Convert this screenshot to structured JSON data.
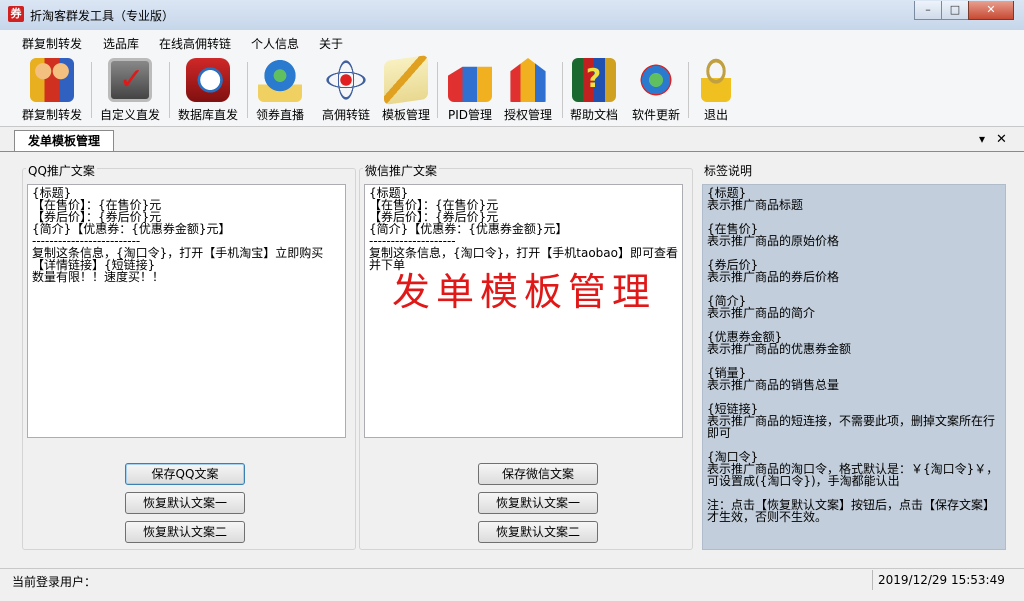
{
  "window": {
    "title": "折淘客群发工具（专业版）",
    "app_icon": "券",
    "minimize": "–",
    "maximize": "□",
    "close": "✕"
  },
  "menu": [
    "群复制转发",
    "选品库",
    "在线高佣转链",
    "个人信息",
    "关于"
  ],
  "toolbar": [
    {
      "label": "群复制转发",
      "icon": "users-icon"
    },
    {
      "label": "自定义直发",
      "icon": "tv-check-icon"
    },
    {
      "label": "数据库直发",
      "icon": "database-clock-icon"
    },
    {
      "label": "领券直播",
      "icon": "globe-paper-icon"
    },
    {
      "label": "高佣转链",
      "icon": "atom-icon"
    },
    {
      "label": "模板管理",
      "icon": "template-pencil-icon"
    },
    {
      "label": "PID管理",
      "icon": "blocks-folder-icon"
    },
    {
      "label": "授权管理",
      "icon": "blocks-hand-icon"
    },
    {
      "label": "帮助文档",
      "icon": "books-help-icon"
    },
    {
      "label": "软件更新",
      "icon": "globe-update-icon"
    },
    {
      "label": "退出",
      "icon": "lock-icon"
    }
  ],
  "tab": {
    "label": "发单模板管理",
    "dropdown": "▾",
    "close": "✕"
  },
  "qq": {
    "label": "QQ推广文案",
    "text": "{标题}\n【在售价】：{在售价}元\n【券后价】：{券后价}元\n{简介}【优惠券：{优惠券金额}元】\n-------------------------\n复制这条信息，{淘口令}，打开【手机淘宝】立即购买\n【详情链接】{短链接}\n数量有限！！速度买！！",
    "save_button": "保存QQ文案",
    "restore1_button": "恢复默认文案一",
    "restore2_button": "恢复默认文案二"
  },
  "wechat": {
    "label": "微信推广文案",
    "text": "{标题}\n【在售价】：{在售价}元\n【券后价】：{券后价}元\n{简介}【优惠券：{优惠券金额}元】\n--------------------\n复制这条信息，{淘口令}，打开【手机taobao】即可查看并下单",
    "watermark": "发单模板管理",
    "save_button": "保存微信文案",
    "restore1_button": "恢复默认文案一",
    "restore2_button": "恢复默认文案二"
  },
  "tags": {
    "label": "标签说明",
    "text": "{标题}\n表示推广商品标题\n\n{在售价}\n表示推广商品的原始价格\n\n{券后价}\n表示推广商品的券后价格\n\n{简介}\n表示推广商品的简介\n\n{优惠券金额}\n表示推广商品的优惠券金额\n\n{销量}\n表示推广商品的销售总量\n\n{短链接}\n表示推广商品的短连接，不需要此项，删掉文案所在行即可\n\n{淘口令}\n表示推广商品的淘口令，格式默认是：￥{淘口令}￥，可设置成({淘口令})，手淘都能认出\n\n注：点击【恢复默认文案】按钮后，点击【保存文案】才生效，否则不生效。"
  },
  "status": {
    "user_label": "当前登录用户：",
    "datetime": "2019/12/29 15:53:49"
  },
  "colors": {
    "watermark": "#e01818",
    "tag_bg": "#c2cedb",
    "accent": "#3c7fb1"
  }
}
